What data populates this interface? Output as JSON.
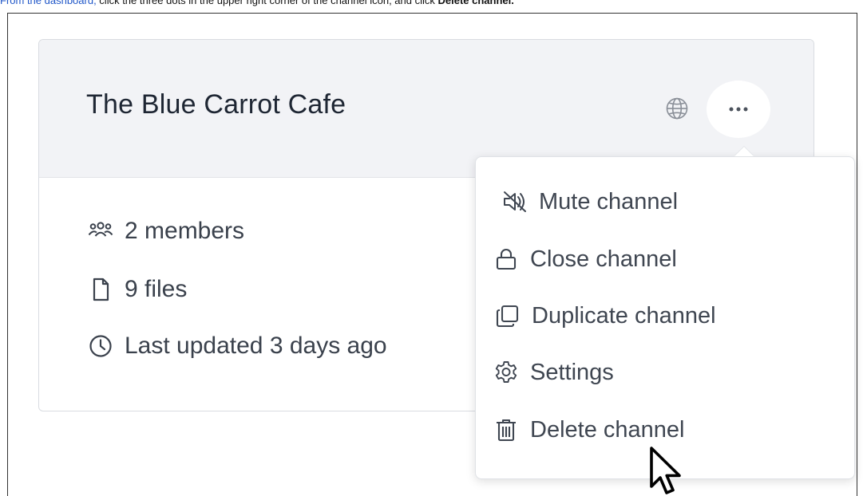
{
  "instruction": {
    "lead": "From the dashboard,",
    "text": " click the three dots in the upper right corner of the channel icon, and click ",
    "emphasis": "Delete channel."
  },
  "channel": {
    "title": "The Blue Carrot Cafe",
    "members": "2 members",
    "files": "9 files",
    "updated": "Last updated 3 days ago"
  },
  "menu": {
    "items": [
      {
        "label": "Mute channel",
        "icon": "mute-icon"
      },
      {
        "label": "Close channel",
        "icon": "lock-icon"
      },
      {
        "label": "Duplicate channel",
        "icon": "duplicate-icon"
      },
      {
        "label": "Settings",
        "icon": "gear-icon"
      },
      {
        "label": "Delete channel",
        "icon": "trash-icon"
      }
    ]
  },
  "colors": {
    "header_bg": "#f2f3f6",
    "text": "#1e2633",
    "muted": "#3a414c",
    "lead_link": "#1f56c8"
  }
}
